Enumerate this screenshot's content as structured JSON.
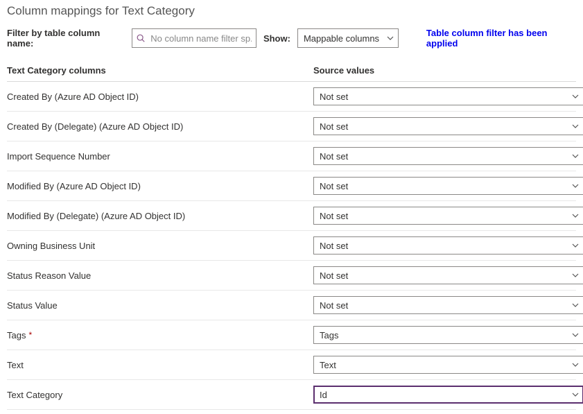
{
  "page_title": "Column mappings for Text Category",
  "filter": {
    "label": "Filter by table column name:",
    "placeholder": "No column name filter sp..."
  },
  "show": {
    "label": "Show:",
    "value": "Mappable columns"
  },
  "filter_notice": "Table column filter has been applied",
  "table": {
    "headers": {
      "column": "Text Category columns",
      "source": "Source values"
    },
    "rows": [
      {
        "name": "Created By (Azure AD Object ID)",
        "value": "Not set",
        "required": false
      },
      {
        "name": "Created By (Delegate) (Azure AD Object ID)",
        "value": "Not set",
        "required": false
      },
      {
        "name": "Import Sequence Number",
        "value": "Not set",
        "required": false
      },
      {
        "name": "Modified By (Azure AD Object ID)",
        "value": "Not set",
        "required": false
      },
      {
        "name": "Modified By (Delegate) (Azure AD Object ID)",
        "value": "Not set",
        "required": false
      },
      {
        "name": "Owning Business Unit",
        "value": "Not set",
        "required": false
      },
      {
        "name": "Status Reason Value",
        "value": "Not set",
        "required": false
      },
      {
        "name": "Status Value",
        "value": "Not set",
        "required": false
      },
      {
        "name": "Tags",
        "value": "Tags",
        "required": true
      },
      {
        "name": "Text",
        "value": "Text",
        "required": false
      },
      {
        "name": "Text Category",
        "value": "Id",
        "required": false,
        "focused": true
      }
    ]
  },
  "icons": {
    "required_star": "*"
  }
}
